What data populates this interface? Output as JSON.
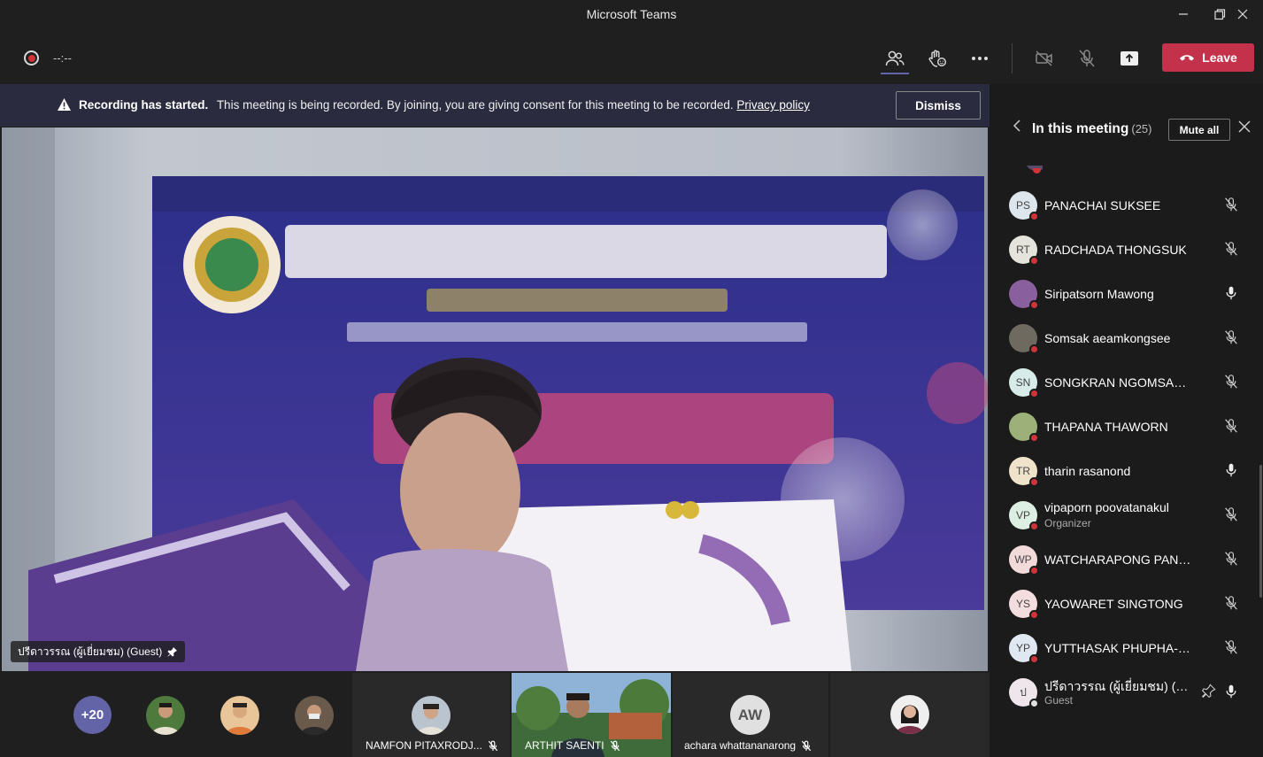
{
  "window": {
    "title": "Microsoft Teams"
  },
  "toolbar": {
    "timer": "--:--",
    "leave_label": "Leave"
  },
  "banner": {
    "bold": "Recording has started.",
    "text": "This meeting is being recorded. By joining, you are giving consent for this meeting to be recorded.",
    "link": "Privacy policy",
    "dismiss_label": "Dismiss"
  },
  "stage": {
    "speaker_caption": "ปรีดาวรรณ (ผู้เยี่ยมชม) (Guest)"
  },
  "strip": {
    "more_count": "+20",
    "tiles": [
      {
        "name": "NAMFON PITAXRODJ..."
      },
      {
        "name": "ARTHIT SAENTI"
      },
      {
        "name": "achara whattananarong",
        "initials": "AW"
      }
    ]
  },
  "panel": {
    "title": "In this meeting",
    "count": "(25)",
    "mute_all_label": "Mute all",
    "participants": [
      {
        "initials": "PS",
        "name": "PANACHAI SUKSEE",
        "mic": "muted",
        "avatar_color": "#dde6ec"
      },
      {
        "initials": "RT",
        "name": "RADCHADA THONGSUK",
        "mic": "muted",
        "avatar_color": "#e4e4dc"
      },
      {
        "initials": "",
        "name": "Siripatsorn Mawong",
        "mic": "on",
        "avatar_color": "#8a5f9e"
      },
      {
        "initials": "",
        "name": "Somsak aeamkongsee",
        "mic": "muted",
        "avatar_color": "#6e6a60"
      },
      {
        "initials": "SN",
        "name": "SONGKRAN NGOMSAKHOO",
        "mic": "muted",
        "avatar_color": "#d7ece8"
      },
      {
        "initials": "",
        "name": "THAPANA THAWORN",
        "mic": "muted",
        "avatar_color": "#9db07a"
      },
      {
        "initials": "TR",
        "name": "tharin rasanond",
        "mic": "on",
        "avatar_color": "#f0e3cc"
      },
      {
        "initials": "VP",
        "name": "vipaporn poovatanakul",
        "role": "Organizer",
        "mic": "muted",
        "avatar_color": "#dcefe2"
      },
      {
        "initials": "WP",
        "name": "WATCHARAPONG PANITTUM...",
        "mic": "muted",
        "avatar_color": "#f3dada"
      },
      {
        "initials": "YS",
        "name": "YAOWARET SINGTONG",
        "mic": "muted",
        "avatar_color": "#f4dddf"
      },
      {
        "initials": "YP",
        "name": "YUTTHASAK PHUPHA-ARAK",
        "mic": "muted",
        "avatar_color": "#dfe7f0"
      },
      {
        "initials": "ป",
        "name": "ปรีดาวรรณ (ผู้เยี่ยมชม) (Gu...",
        "role": "Guest",
        "mic": "on",
        "pinned": true,
        "avatar_color": "#efe6ec"
      }
    ]
  }
}
